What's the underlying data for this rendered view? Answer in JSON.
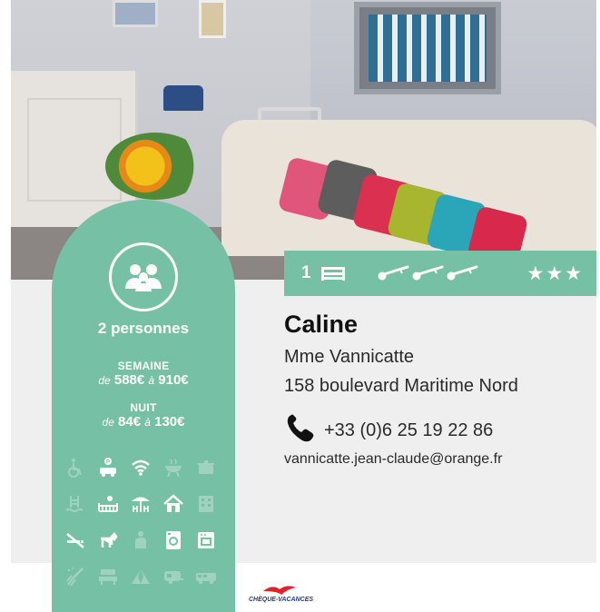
{
  "listing": {
    "persons": "2 personnes",
    "week_label": "SEMAINE",
    "week_prefix": "de",
    "week_min": "588€",
    "week_sep": "à",
    "week_max": "910€",
    "night_label": "NUIT",
    "night_prefix": "de",
    "night_min": "84€",
    "night_sep": "à",
    "night_max": "130€",
    "rooms": "1",
    "stars": "★★★",
    "name": "Caline",
    "owner": "Mme Vannicatte",
    "address": "158 boulevard Maritime Nord",
    "phone": "+33 (0)6 25 19 22 86",
    "email": "vannicatte.jean-claude@orange.fr",
    "cheque_label": "CHÈQUE-VACANCES"
  },
  "amenities": [
    {
      "icon": "wheelchair-icon",
      "active": false
    },
    {
      "icon": "parking-car-icon",
      "active": true
    },
    {
      "icon": "wifi-icon",
      "active": true
    },
    {
      "icon": "barbecue-icon",
      "active": false
    },
    {
      "icon": "cooking-pot-icon",
      "active": false
    },
    {
      "icon": "pool-icon",
      "active": false
    },
    {
      "icon": "child-bed-icon",
      "active": true
    },
    {
      "icon": "garden-terrace-icon",
      "active": true
    },
    {
      "icon": "house-icon",
      "active": true
    },
    {
      "icon": "apartment-building-icon",
      "active": false
    },
    {
      "icon": "no-smoking-icon",
      "active": true
    },
    {
      "icon": "pets-allowed-icon",
      "active": true
    },
    {
      "icon": "person-assist-icon",
      "active": false
    },
    {
      "icon": "washing-machine-icon",
      "active": true
    },
    {
      "icon": "oven-icon",
      "active": true
    },
    {
      "icon": "cleaning-service-icon",
      "active": false
    },
    {
      "icon": "lounge-chair-icon",
      "active": false
    },
    {
      "icon": "tent-icon",
      "active": false
    },
    {
      "icon": "caravan-icon",
      "active": false
    },
    {
      "icon": "camper-van-icon",
      "active": false
    }
  ],
  "colors": {
    "accent": "#76c1a5",
    "band": "#efefef",
    "icon_active": "#ffffff",
    "icon_inactive": "#9fd3c0"
  }
}
